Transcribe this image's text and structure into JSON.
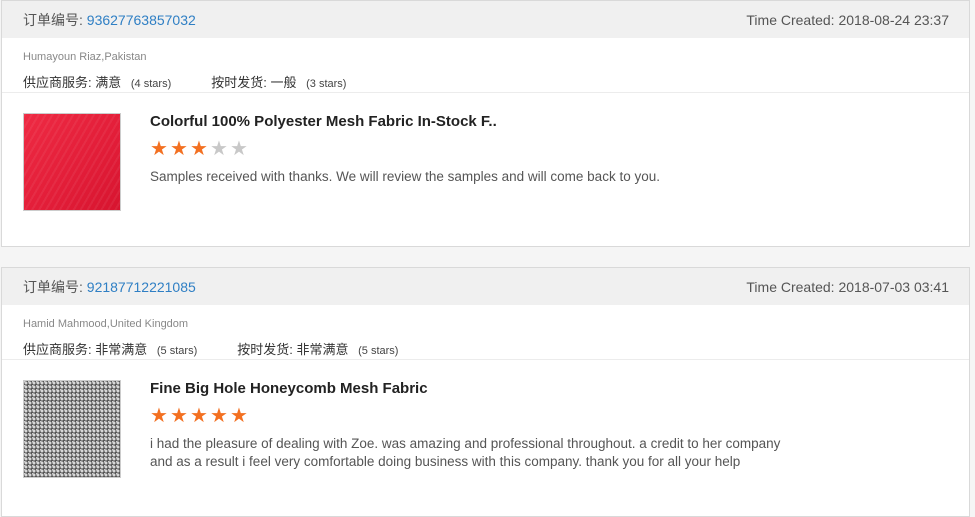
{
  "orders": [
    {
      "order_label": "订单编号:",
      "order_number": "93627763857032",
      "time_created": "Time Created: 2018-08-24 23:37",
      "buyer": "Humayoun Riaz,Pakistan",
      "supplier_service_label": "供应商服务:",
      "supplier_service_value": "满意",
      "supplier_service_stars": "(4 stars)",
      "shipping_label": "按时发货:",
      "shipping_value": "一般",
      "shipping_stars": "(3 stars)",
      "product_title": "Colorful 100% Polyester Mesh Fabric In-Stock F..",
      "rating": 3,
      "review": "Samples received with thanks. We will review the samples and will come back to you."
    },
    {
      "order_label": "订单编号:",
      "order_number": "92187712221085",
      "time_created": "Time Created: 2018-07-03 03:41",
      "buyer": "Hamid Mahmood,United Kingdom",
      "supplier_service_label": "供应商服务:",
      "supplier_service_value": "非常满意",
      "supplier_service_stars": "(5 stars)",
      "shipping_label": "按时发货:",
      "shipping_value": "非常满意",
      "shipping_stars": "(5 stars)",
      "product_title": "Fine Big Hole Honeycomb Mesh Fabric",
      "rating": 5,
      "review": "i had the pleasure of dealing with Zoe. was amazing and professional throughout. a credit to her company and as a result i feel very comfortable doing business with this company. thank you for all your help"
    }
  ],
  "colors": {
    "accent_link": "#2f7fc4",
    "star_on": "#f37021",
    "star_off": "#c8c8c8"
  }
}
